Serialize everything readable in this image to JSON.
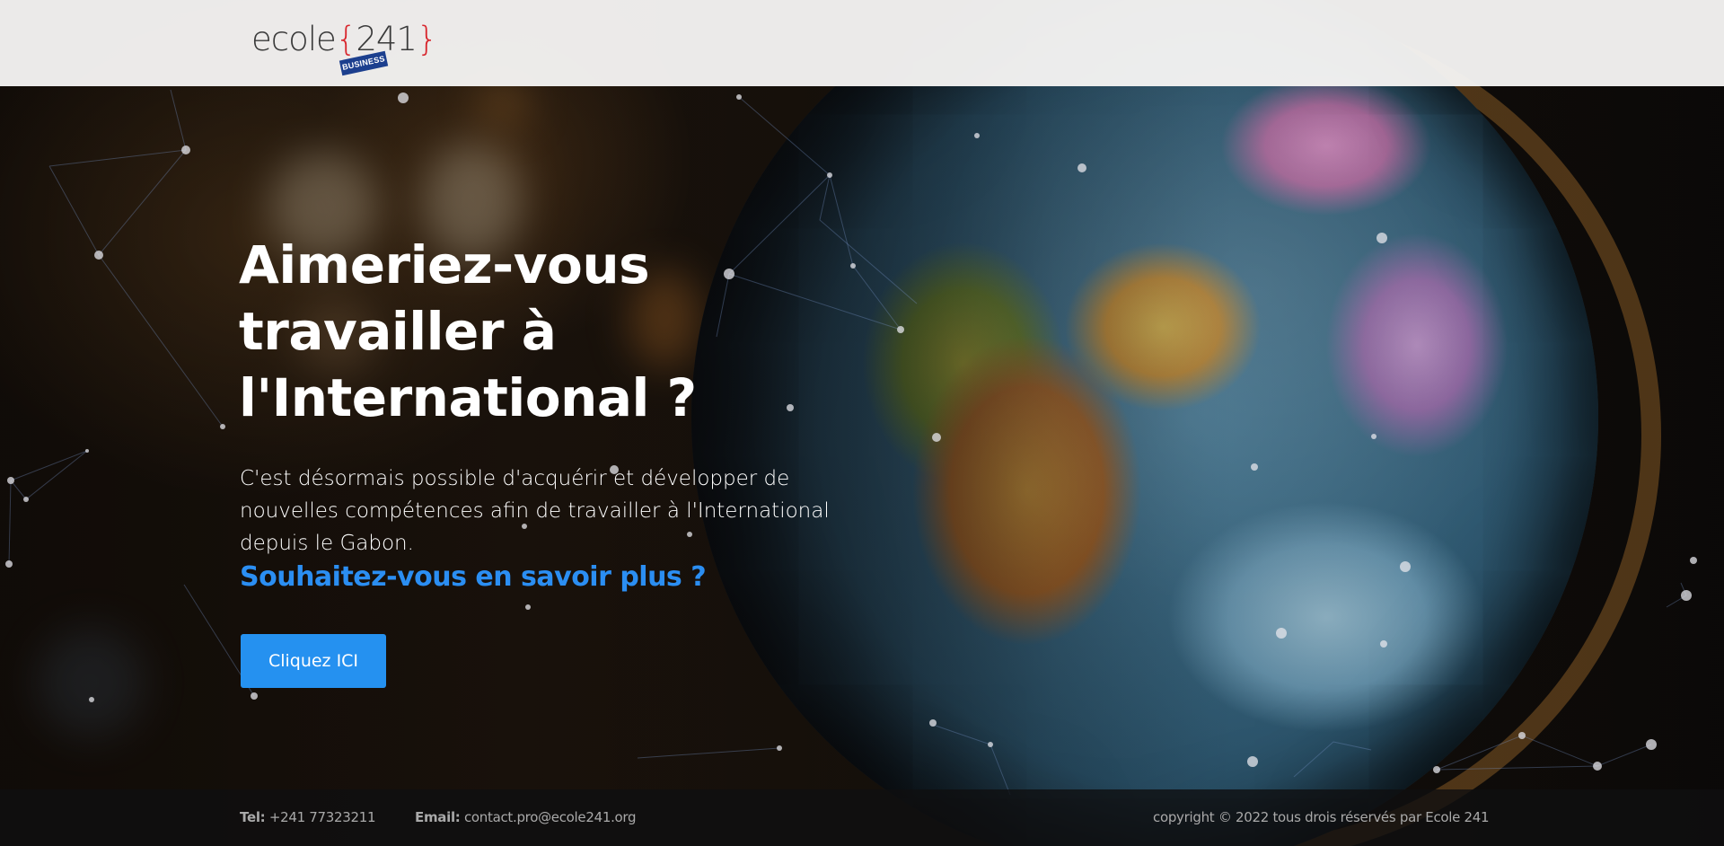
{
  "header": {
    "logo_word": "ecole",
    "logo_brace_open": "{",
    "logo_number": "241",
    "logo_brace_close": "}",
    "logo_badge": "BUSINESS"
  },
  "hero": {
    "title_line1": "Aimeriez-vous",
    "title_line2": "travailler à",
    "title_line3": "l'International ?",
    "description": "C'est désormais possible d'acquérir et développer de nouvelles compétences afin de travailler à l'International depuis le Gabon.",
    "cta_text": "Souhaitez-vous en savoir plus ?",
    "button_label": "Cliquez ICI"
  },
  "footer": {
    "tel_label": "Tel:",
    "tel_value": "+241 77323211",
    "email_label": "Email:",
    "email_value": "contact.pro@ecole241.org",
    "copyright": "copyright © 2022 tous drois réservés par Ecole 241"
  },
  "colors": {
    "accent_blue": "#2591f0",
    "cta_text_blue": "#2b8ef2",
    "logo_red": "#d8262d",
    "badge_navy": "#1c3f8e",
    "header_bg": "#f5f4f3"
  },
  "icons": {
    "background": "globe-photo-with-network-lines"
  }
}
